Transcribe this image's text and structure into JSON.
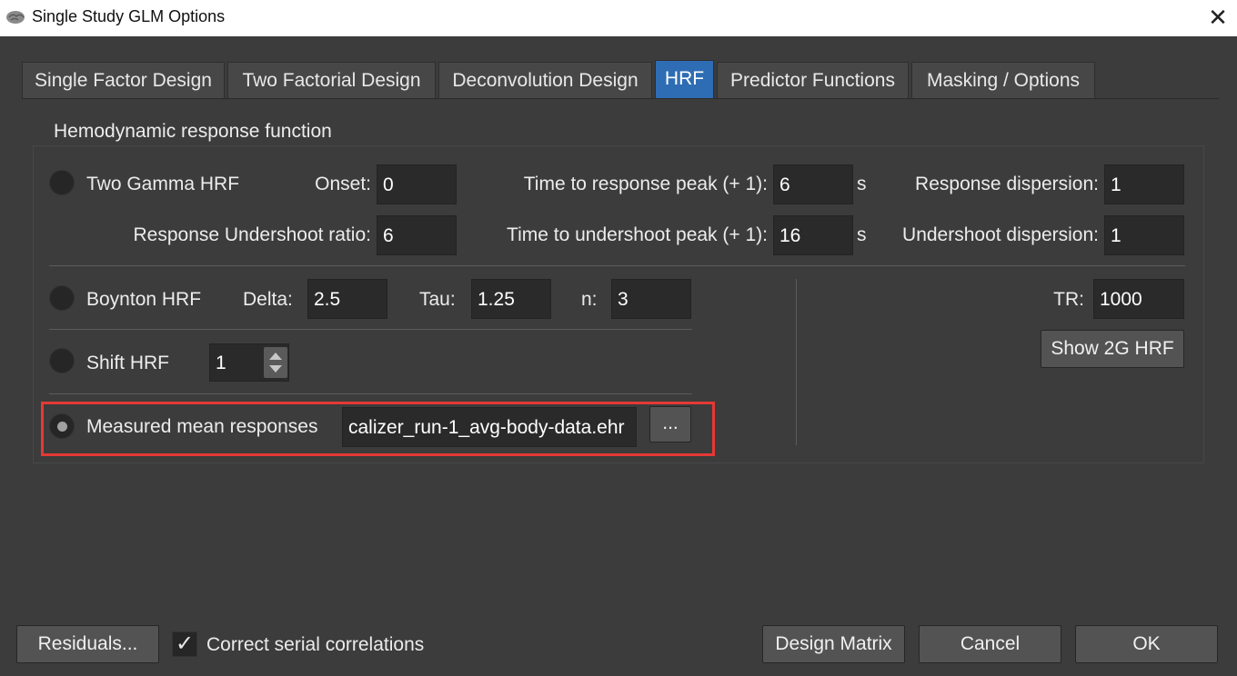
{
  "window": {
    "title": "Single Study GLM Options",
    "close_glyph": "✕"
  },
  "tabs": [
    {
      "label": "Single Factor Design",
      "active": false
    },
    {
      "label": "Two Factorial Design",
      "active": false
    },
    {
      "label": "Deconvolution Design",
      "active": false
    },
    {
      "label": "HRF",
      "active": true
    },
    {
      "label": "Predictor Functions",
      "active": false
    },
    {
      "label": "Masking / Options",
      "active": false
    }
  ],
  "group": {
    "title": "Hemodynamic response function"
  },
  "two_gamma": {
    "radio_label": "Two Gamma HRF",
    "onset_label": "Onset:",
    "onset_value": "0",
    "peak_label": "Time to response peak (+ 1):",
    "peak_value": "6",
    "peak_unit": "s",
    "resp_disp_label": "Response dispersion:",
    "resp_disp_value": "1",
    "undershoot_ratio_label": "Response Undershoot ratio:",
    "undershoot_ratio_value": "6",
    "undershoot_peak_label": "Time to undershoot peak (+ 1):",
    "undershoot_peak_value": "16",
    "undershoot_peak_unit": "s",
    "undershoot_disp_label": "Undershoot dispersion:",
    "undershoot_disp_value": "1"
  },
  "boynton": {
    "radio_label": "Boynton HRF",
    "delta_label": "Delta:",
    "delta_value": "2.5",
    "tau_label": "Tau:",
    "tau_value": "1.25",
    "n_label": "n:",
    "n_value": "3"
  },
  "shift": {
    "radio_label": "Shift HRF",
    "value": "1"
  },
  "measured": {
    "radio_label": "Measured mean responses",
    "file_value": "calizer_run-1_avg-body-data.ehr",
    "browse_label": "..."
  },
  "tr": {
    "label": "TR:",
    "value": "1000",
    "show_button": "Show 2G HRF"
  },
  "footer": {
    "residuals_button": "Residuals...",
    "correct_checkbox_label": "Correct serial correlations",
    "correct_checked": true,
    "check_glyph": "✓",
    "design_matrix_button": "Design Matrix",
    "cancel_button": "Cancel",
    "ok_button": "OK"
  },
  "colors": {
    "background": "#3c3c3c",
    "active_tab": "#2e6db4",
    "highlight": "#e53935",
    "field": "#2a2a2a"
  }
}
